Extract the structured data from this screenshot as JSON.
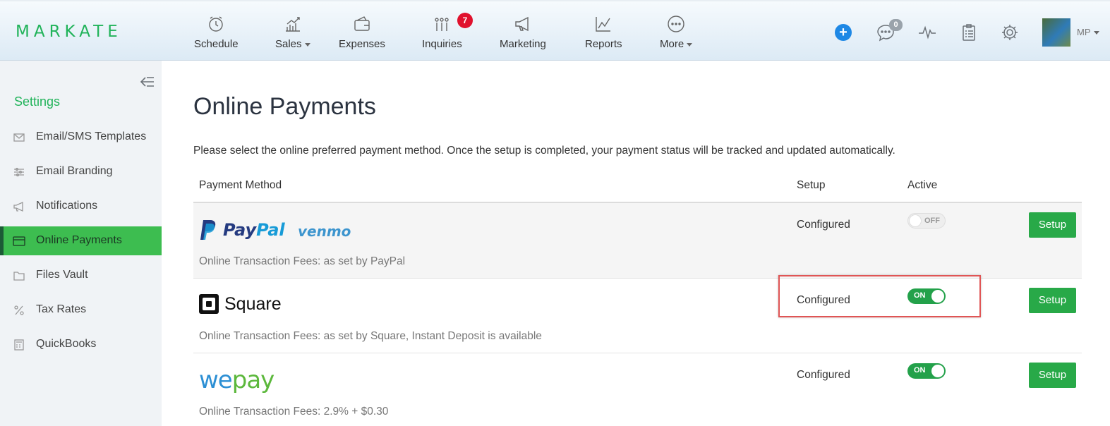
{
  "brand": {
    "logo_text": "MARKATE",
    "accent": "#21b35a"
  },
  "nav": {
    "items": [
      {
        "label": "Schedule",
        "icon": "alarm-clock-icon"
      },
      {
        "label": "Sales",
        "icon": "sales-chart-icon"
      },
      {
        "label": "Expenses",
        "icon": "wallet-icon"
      },
      {
        "label": "Inquiries",
        "icon": "inquiries-icon",
        "badge": "7"
      },
      {
        "label": "Marketing",
        "icon": "megaphone-icon"
      },
      {
        "label": "Reports",
        "icon": "reports-icon"
      },
      {
        "label": "More",
        "icon": "more-dots-icon"
      }
    ]
  },
  "header_right": {
    "chat_badge": "0",
    "user_initials": "MP"
  },
  "sidebar": {
    "title": "Settings",
    "items": [
      {
        "label": "Email/SMS Templates",
        "icon": "envelope-icon"
      },
      {
        "label": "Email Branding",
        "icon": "sliders-icon"
      },
      {
        "label": "Notifications",
        "icon": "megaphone-icon"
      },
      {
        "label": "Online Payments",
        "icon": "credit-card-icon",
        "active": true
      },
      {
        "label": "Files Vault",
        "icon": "folder-icon"
      },
      {
        "label": "Tax Rates",
        "icon": "percent-icon"
      },
      {
        "label": "QuickBooks",
        "icon": "calculator-icon"
      }
    ]
  },
  "main": {
    "title": "Online Payments",
    "description": "Please select the online preferred payment method. Once the setup is completed, your payment status will be tracked and updated automatically.",
    "columns": {
      "method": "Payment Method",
      "setup": "Setup",
      "active": "Active"
    },
    "rows": [
      {
        "provider": "PayPal venmo",
        "logo_paypal_a": "Pay",
        "logo_paypal_b": "Pal",
        "logo_venmo": "venmo",
        "fees": "Online Transaction Fees: as set by PayPal",
        "setup_status": "Configured",
        "toggle_label": "OFF",
        "active": false,
        "button": "Setup"
      },
      {
        "provider": "Square",
        "logo_square": "Square",
        "fees": "Online Transaction Fees: as set by Square, Instant Deposit is available",
        "setup_status": "Configured",
        "toggle_label": "ON",
        "active": true,
        "button": "Setup"
      },
      {
        "provider": "wepay",
        "logo_we": "we",
        "logo_pay": "pay",
        "fees": "Online Transaction Fees: 2.9% + $0.30",
        "setup_status": "Configured",
        "toggle_label": "ON",
        "active": true,
        "button": "Setup"
      }
    ]
  },
  "colors": {
    "active_green": "#3dbd50",
    "button_green": "#28a948",
    "toggle_on": "#23a14a",
    "highlight": "#e05555"
  }
}
